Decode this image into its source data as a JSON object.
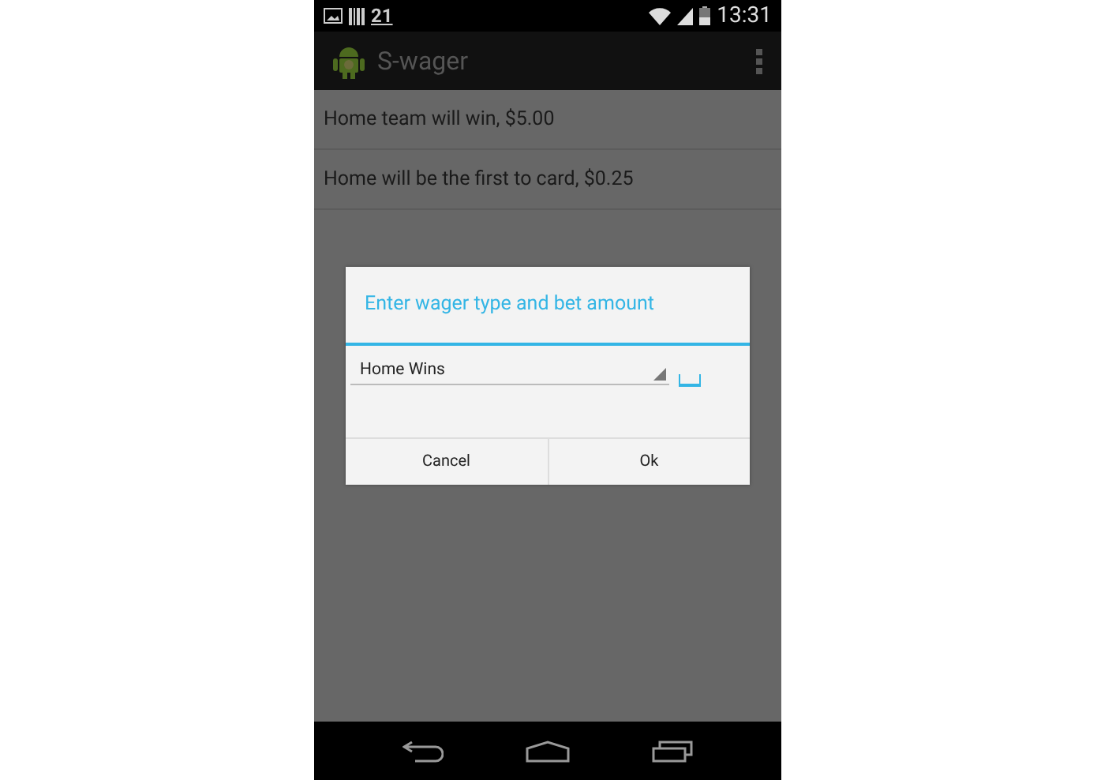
{
  "status_bar": {
    "notification": "21",
    "time": "13:31"
  },
  "action_bar": {
    "title": "S-wager"
  },
  "list": [
    {
      "text": "Home team will win, $5.00"
    },
    {
      "text": "Home will be the first to card, $0.25"
    }
  ],
  "dialog": {
    "title": "Enter wager type and bet amount",
    "spinner": {
      "value": "Home Wins"
    },
    "buttons": [
      "Cancel",
      "Ok"
    ]
  }
}
